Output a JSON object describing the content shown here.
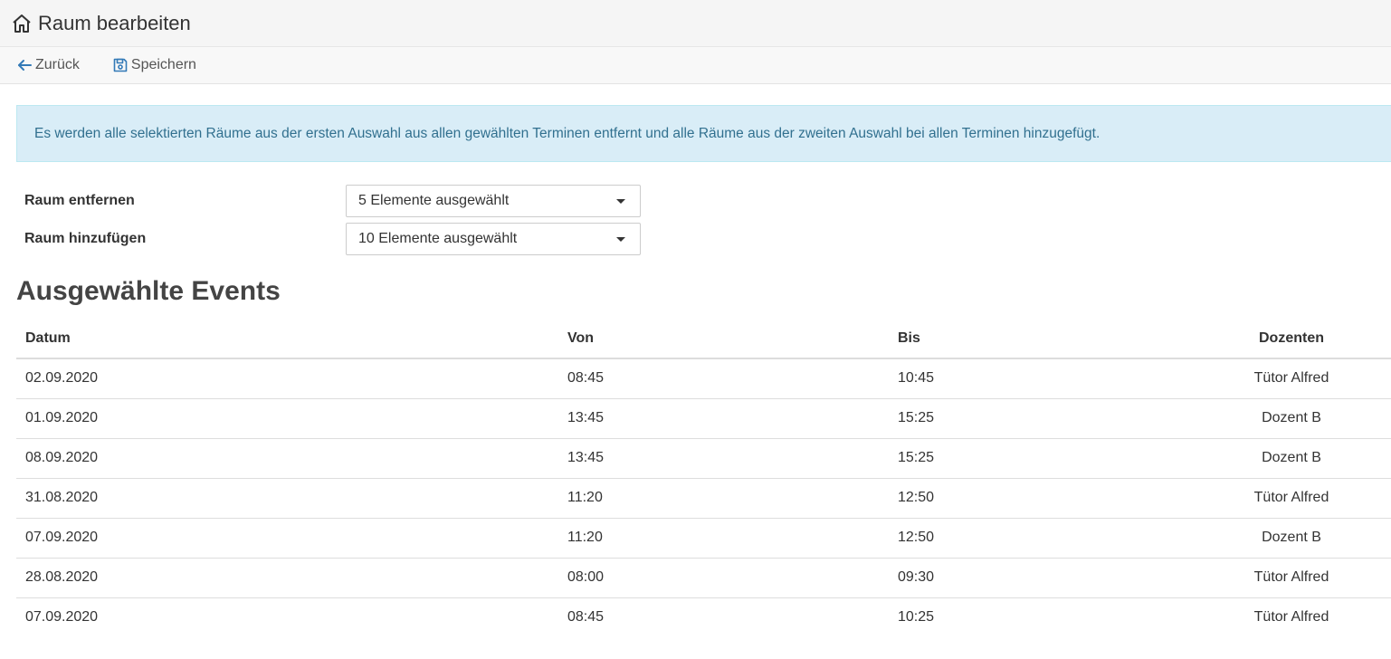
{
  "header": {
    "title": "Raum bearbeiten",
    "icon": "home-icon"
  },
  "toolbar": {
    "back_label": "Zurück",
    "save_label": "Speichern"
  },
  "info": {
    "text": "Es werden alle selektierten Räume aus der ersten Auswahl aus allen gewählten Terminen entfernt und alle Räume aus der zweiten Auswahl bei allen Terminen hinzugefügt."
  },
  "form": {
    "remove": {
      "label": "Raum entfernen",
      "value": "5 Elemente ausgewählt"
    },
    "add": {
      "label": "Raum hinzufügen",
      "value": "10 Elemente ausgewählt"
    }
  },
  "events": {
    "title": "Ausgewählte Events",
    "columns": [
      "Datum",
      "Von",
      "Bis",
      "Dozenten"
    ],
    "rows": [
      [
        "02.09.2020",
        "08:45",
        "10:45",
        "Tütor Alfred"
      ],
      [
        "01.09.2020",
        "13:45",
        "15:25",
        "Dozent B"
      ],
      [
        "08.09.2020",
        "13:45",
        "15:25",
        "Dozent B"
      ],
      [
        "31.08.2020",
        "11:20",
        "12:50",
        "Tütor Alfred"
      ],
      [
        "07.09.2020",
        "11:20",
        "12:50",
        "Dozent B"
      ],
      [
        "28.08.2020",
        "08:00",
        "09:30",
        "Tütor Alfred"
      ],
      [
        "07.09.2020",
        "08:45",
        "10:25",
        "Tütor Alfred"
      ]
    ]
  },
  "colors": {
    "info_bg": "#d9edf7",
    "info_text": "#31708f",
    "accent": "#337ab7"
  }
}
